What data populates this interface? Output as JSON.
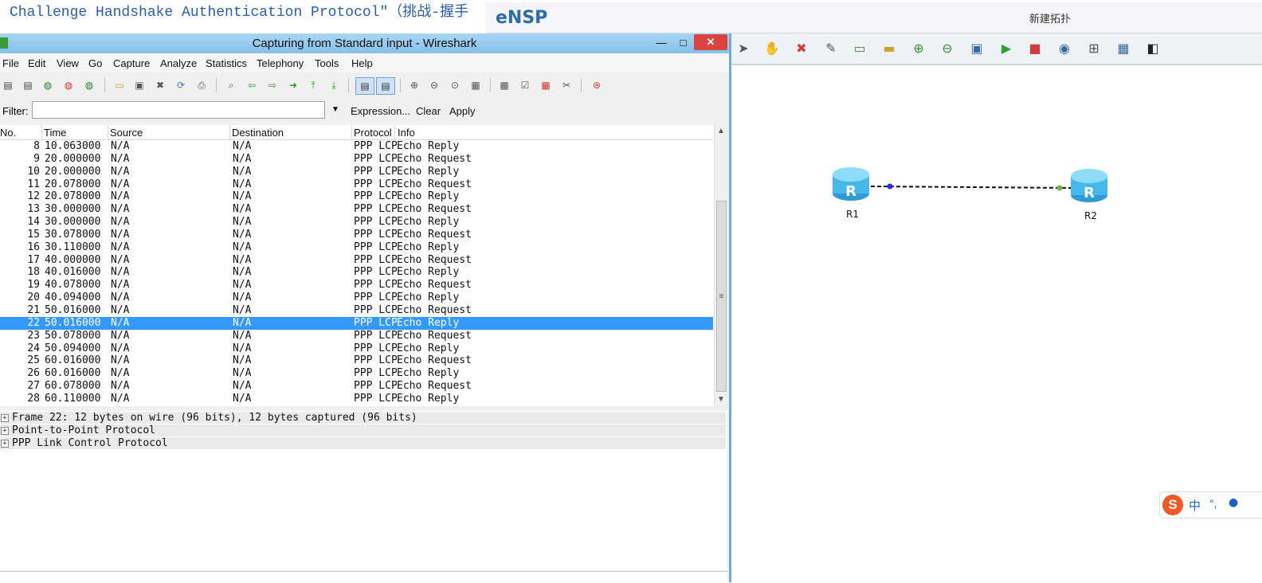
{
  "background_text": "Challenge Handshake Authentication Protocol\"（挑战-握手",
  "ensp": {
    "logo": "eNSP",
    "tab_title": "新建拓扑",
    "toolbar_icons": [
      "pointer-icon",
      "hand-icon",
      "delete-icon",
      "eraser-icon",
      "text-note-icon",
      "rectangle-icon",
      "zoom-in-icon",
      "zoom-out-icon",
      "fit-icon",
      "start-icon",
      "stop-icon",
      "capture-icon",
      "topology-icon",
      "grid-icon",
      "screenshot-icon"
    ],
    "routers": [
      {
        "label": "R1"
      },
      {
        "label": "R2"
      }
    ],
    "ime": {
      "logo": "S",
      "lang": "中",
      "punct": "°,",
      "mic": "🎤"
    }
  },
  "wireshark": {
    "title": "Capturing from Standard input - Wireshark",
    "window_buttons": {
      "minimize": "—",
      "maximize": "□",
      "close": "✕"
    },
    "menus": [
      "File",
      "Edit",
      "View",
      "Go",
      "Capture",
      "Analyze",
      "Statistics",
      "Telephony",
      "Tools",
      "Help"
    ],
    "filter": {
      "label": "Filter:",
      "value": "",
      "expression": "Expression...",
      "clear": "Clear",
      "apply": "Apply"
    },
    "columns": {
      "no": "No.",
      "time": "Time",
      "source": "Source",
      "destination": "Destination",
      "protocol": "Protocol",
      "info": "Info"
    },
    "packets": [
      {
        "no": "8",
        "time": "10.063000",
        "source": "N/A",
        "destination": "N/A",
        "protocol": "PPP LCP",
        "info": "Echo Reply"
      },
      {
        "no": "9",
        "time": "20.000000",
        "source": "N/A",
        "destination": "N/A",
        "protocol": "PPP LCP",
        "info": "Echo Request"
      },
      {
        "no": "10",
        "time": "20.000000",
        "source": "N/A",
        "destination": "N/A",
        "protocol": "PPP LCP",
        "info": "Echo Reply"
      },
      {
        "no": "11",
        "time": "20.078000",
        "source": "N/A",
        "destination": "N/A",
        "protocol": "PPP LCP",
        "info": "Echo Request"
      },
      {
        "no": "12",
        "time": "20.078000",
        "source": "N/A",
        "destination": "N/A",
        "protocol": "PPP LCP",
        "info": "Echo Reply"
      },
      {
        "no": "13",
        "time": "30.000000",
        "source": "N/A",
        "destination": "N/A",
        "protocol": "PPP LCP",
        "info": "Echo Request"
      },
      {
        "no": "14",
        "time": "30.000000",
        "source": "N/A",
        "destination": "N/A",
        "protocol": "PPP LCP",
        "info": "Echo Reply"
      },
      {
        "no": "15",
        "time": "30.078000",
        "source": "N/A",
        "destination": "N/A",
        "protocol": "PPP LCP",
        "info": "Echo Request"
      },
      {
        "no": "16",
        "time": "30.110000",
        "source": "N/A",
        "destination": "N/A",
        "protocol": "PPP LCP",
        "info": "Echo Reply"
      },
      {
        "no": "17",
        "time": "40.000000",
        "source": "N/A",
        "destination": "N/A",
        "protocol": "PPP LCP",
        "info": "Echo Request"
      },
      {
        "no": "18",
        "time": "40.016000",
        "source": "N/A",
        "destination": "N/A",
        "protocol": "PPP LCP",
        "info": "Echo Reply"
      },
      {
        "no": "19",
        "time": "40.078000",
        "source": "N/A",
        "destination": "N/A",
        "protocol": "PPP LCP",
        "info": "Echo Request"
      },
      {
        "no": "20",
        "time": "40.094000",
        "source": "N/A",
        "destination": "N/A",
        "protocol": "PPP LCP",
        "info": "Echo Reply"
      },
      {
        "no": "21",
        "time": "50.016000",
        "source": "N/A",
        "destination": "N/A",
        "protocol": "PPP LCP",
        "info": "Echo Request"
      },
      {
        "no": "22",
        "time": "50.016000",
        "source": "N/A",
        "destination": "N/A",
        "protocol": "PPP LCP",
        "info": "Echo Reply",
        "selected": true
      },
      {
        "no": "23",
        "time": "50.078000",
        "source": "N/A",
        "destination": "N/A",
        "protocol": "PPP LCP",
        "info": "Echo Request"
      },
      {
        "no": "24",
        "time": "50.094000",
        "source": "N/A",
        "destination": "N/A",
        "protocol": "PPP LCP",
        "info": "Echo Reply"
      },
      {
        "no": "25",
        "time": "60.016000",
        "source": "N/A",
        "destination": "N/A",
        "protocol": "PPP LCP",
        "info": "Echo Request"
      },
      {
        "no": "26",
        "time": "60.016000",
        "source": "N/A",
        "destination": "N/A",
        "protocol": "PPP LCP",
        "info": "Echo Reply"
      },
      {
        "no": "27",
        "time": "60.078000",
        "source": "N/A",
        "destination": "N/A",
        "protocol": "PPP LCP",
        "info": "Echo Request"
      },
      {
        "no": "28",
        "time": "60.110000",
        "source": "N/A",
        "destination": "N/A",
        "protocol": "PPP LCP",
        "info": "Echo Reply"
      }
    ],
    "details": [
      "Frame 22: 12 bytes on wire (96 bits), 12 bytes captured (96 bits)",
      "Point-to-Point Protocol",
      "PPP Link Control Protocol"
    ],
    "selected_color": "#3399ff"
  }
}
